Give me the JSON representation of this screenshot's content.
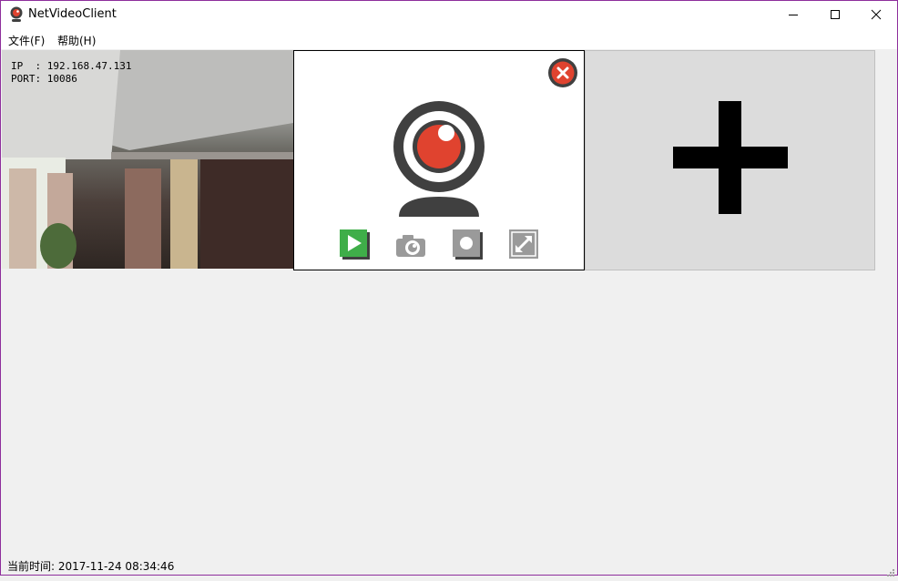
{
  "window": {
    "title": "NetVideoClient",
    "border_color": "#8e2e9c"
  },
  "window_controls": {
    "minimize_icon": "minimize-icon",
    "maximize_icon": "maximize-icon",
    "close_icon": "close-icon"
  },
  "menu": {
    "items": [
      {
        "label": "文件(F)"
      },
      {
        "label": "帮助(H)"
      }
    ]
  },
  "camera_view": {
    "ip_line": "IP  : 192.168.47.131",
    "port_line": "PORT: 10086"
  },
  "camera_panel": {
    "icons": [
      "webcam-icon",
      "close-icon",
      "play-icon",
      "snapshot-camera-icon",
      "record-icon",
      "fullscreen-icon"
    ],
    "colors": {
      "accent_red": "#e0432f",
      "play_green": "#3fae49",
      "gray": "#9a9a9a",
      "dark": "#404040"
    }
  },
  "add_panel": {
    "icon": "add-plus-icon"
  },
  "status": {
    "label": "当前时间:",
    "time": "2017-11-24 08:34:46"
  }
}
